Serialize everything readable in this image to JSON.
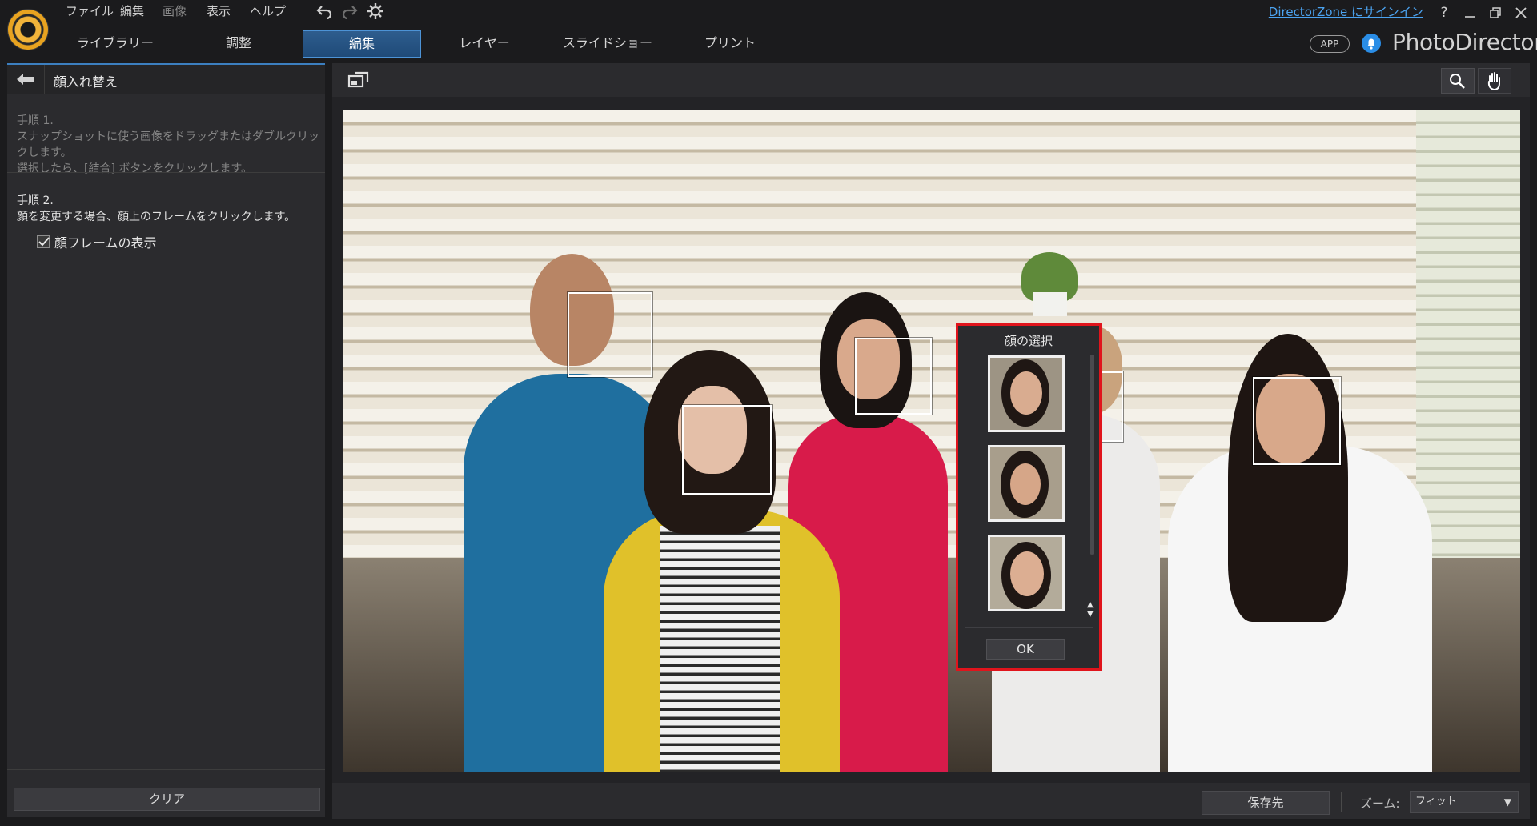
{
  "app": {
    "brand": "PhotoDirector"
  },
  "menu": {
    "file": "ファイル",
    "edit": "編集",
    "image": "画像",
    "view": "表示",
    "help": "ヘルプ"
  },
  "toolbar_icons": [
    "undo-icon",
    "redo-icon",
    "settings-icon"
  ],
  "nav_tabs": [
    {
      "label": "ライブラリー",
      "active": false
    },
    {
      "label": "調整",
      "active": false
    },
    {
      "label": "編集",
      "active": true
    },
    {
      "label": "レイヤー",
      "active": false
    },
    {
      "label": "スライドショー",
      "active": false
    },
    {
      "label": "プリント",
      "active": false
    }
  ],
  "header_right": {
    "signin": "DirectorZone にサインイン",
    "help": "?",
    "app_badge": "APP"
  },
  "left_panel": {
    "title": "顔入れ替え",
    "step1_title": "手順 1.",
    "step1_line1": "スナップショットに使う画像をドラッグまたはダブルクリックします。",
    "step1_line2": "選択したら、[結合] ボタンをクリックします。",
    "step2_title": "手順 2.",
    "step2_line1": "顔を変更する場合、顔上のフレームをクリックします。",
    "checkbox_label": "顔フレームの表示",
    "checkbox_checked": true,
    "clear_button": "クリア"
  },
  "face_select": {
    "title": "顔の選択",
    "ok": "OK",
    "thumb_count": 3
  },
  "bottom_bar": {
    "save": "保存先",
    "zoom_label": "ズーム:",
    "zoom_value": "フィット"
  },
  "colors": {
    "accent_blue": "#3c7fc0",
    "popup_border": "#e0141c",
    "link": "#4ba3f0"
  }
}
